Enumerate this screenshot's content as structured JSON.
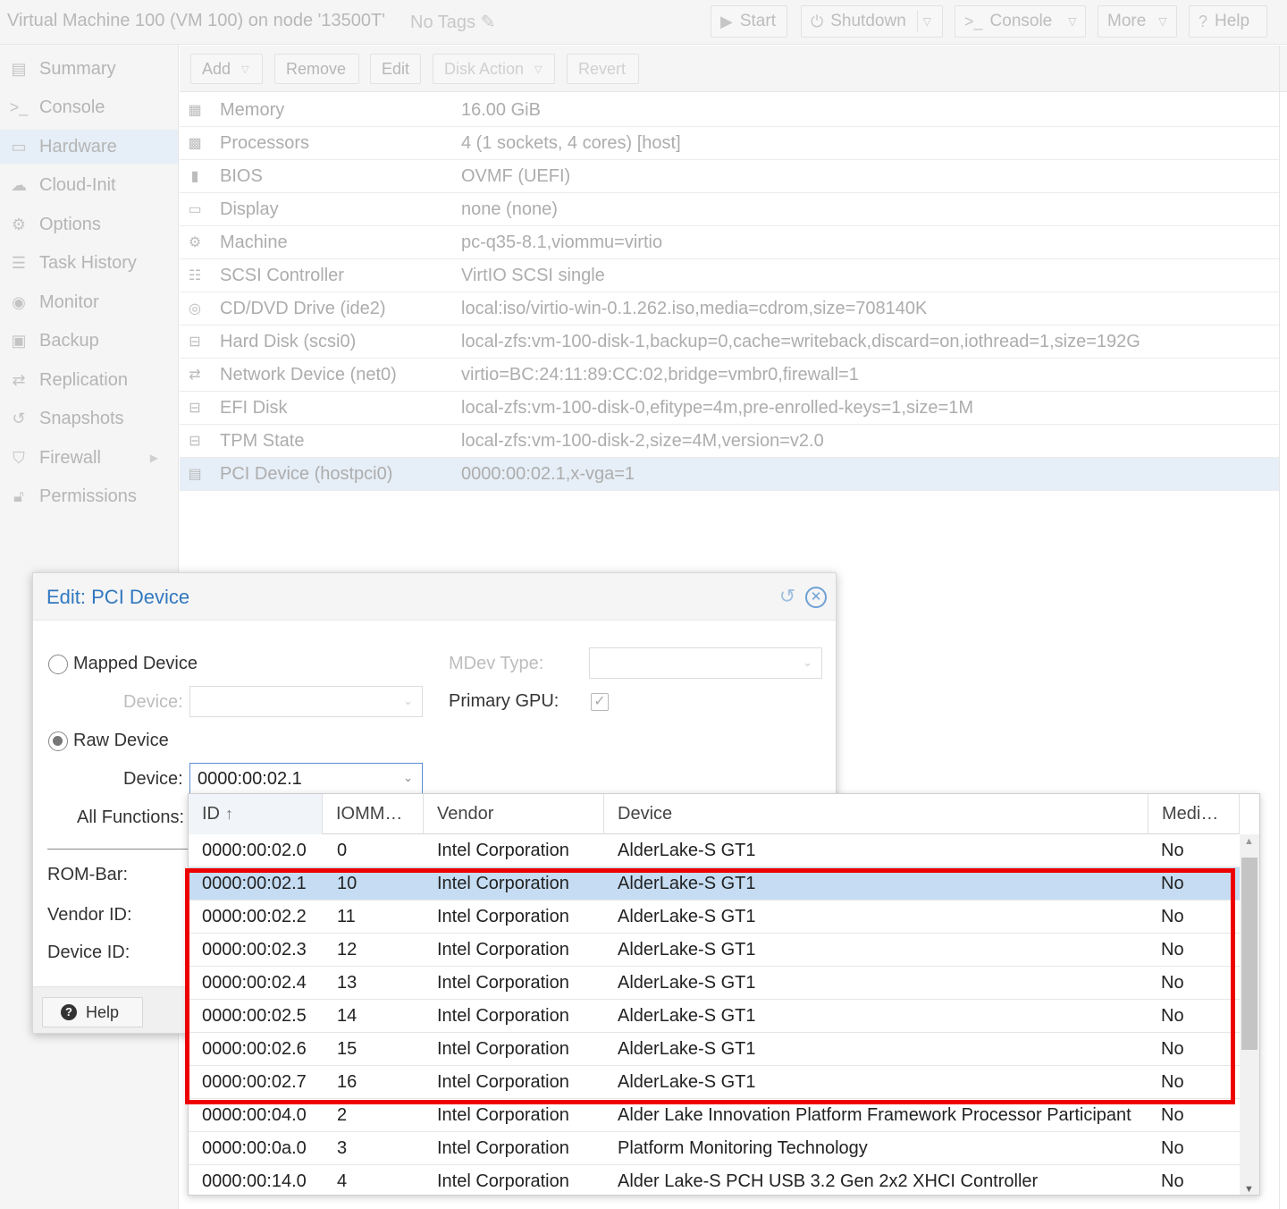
{
  "header": {
    "title": "Virtual Machine 100 (VM 100) on node '13500T'",
    "tags": "No Tags",
    "buttons": {
      "start": "Start",
      "shutdown": "Shutdown",
      "console": "Console",
      "more": "More",
      "help": "Help"
    }
  },
  "sidebar": {
    "items": [
      {
        "label": "Summary",
        "icon": "book-icon"
      },
      {
        "label": "Console",
        "icon": "terminal-icon"
      },
      {
        "label": "Hardware",
        "icon": "desktop-icon",
        "active": true
      },
      {
        "label": "Cloud-Init",
        "icon": "cloud-icon"
      },
      {
        "label": "Options",
        "icon": "gear-icon"
      },
      {
        "label": "Task History",
        "icon": "list-icon"
      },
      {
        "label": "Monitor",
        "icon": "eye-icon"
      },
      {
        "label": "Backup",
        "icon": "floppy-icon"
      },
      {
        "label": "Replication",
        "icon": "retweet-icon"
      },
      {
        "label": "Snapshots",
        "icon": "history-icon"
      },
      {
        "label": "Firewall",
        "icon": "shield-icon"
      },
      {
        "label": "Permissions",
        "icon": "unlock-icon"
      }
    ]
  },
  "toolbar": {
    "add": "Add",
    "remove": "Remove",
    "edit": "Edit",
    "disk_action": "Disk Action",
    "revert": "Revert"
  },
  "hardware": [
    {
      "key": "Memory",
      "value": "16.00 GiB",
      "icon": "memory-icon"
    },
    {
      "key": "Processors",
      "value": "4 (1 sockets, 4 cores) [host]",
      "icon": "cpu-icon"
    },
    {
      "key": "BIOS",
      "value": "OVMF (UEFI)",
      "icon": "microchip-icon"
    },
    {
      "key": "Display",
      "value": "none (none)",
      "icon": "monitor-icon"
    },
    {
      "key": "Machine",
      "value": "pc-q35-8.1,viommu=virtio",
      "icon": "cogs-icon"
    },
    {
      "key": "SCSI Controller",
      "value": "VirtIO SCSI single",
      "icon": "database-icon"
    },
    {
      "key": "CD/DVD Drive (ide2)",
      "value": "local:iso/virtio-win-0.1.262.iso,media=cdrom,size=708140K",
      "icon": "cdrom-icon"
    },
    {
      "key": "Hard Disk (scsi0)",
      "value": "local-zfs:vm-100-disk-1,backup=0,cache=writeback,discard=on,iothread=1,size=192G",
      "icon": "hdd-icon"
    },
    {
      "key": "Network Device (net0)",
      "value": "virtio=BC:24:11:89:CC:02,bridge=vmbr0,firewall=1",
      "icon": "exchange-icon"
    },
    {
      "key": "EFI Disk",
      "value": "local-zfs:vm-100-disk-0,efitype=4m,pre-enrolled-keys=1,size=1M",
      "icon": "hdd-icon"
    },
    {
      "key": "TPM State",
      "value": "local-zfs:vm-100-disk-2,size=4M,version=v2.0",
      "icon": "hdd-icon"
    },
    {
      "key": "PCI Device (hostpci0)",
      "value": "0000:00:02.1,x-vga=1",
      "icon": "pci-card-icon",
      "selected": true
    }
  ],
  "dialog": {
    "title": "Edit: PCI Device",
    "mapped_device": "Mapped Device",
    "device_label": "Device:",
    "mdev_type": "MDev Type:",
    "primary_gpu": "Primary GPU:",
    "raw_device": "Raw Device",
    "raw_device_value": "0000:00:02.1",
    "all_functions": "All Functions:",
    "rom_bar": "ROM-Bar:",
    "vendor_id": "Vendor ID:",
    "device_id": "Device ID:",
    "help": "Help"
  },
  "picker": {
    "columns": [
      "ID",
      "IOMM…",
      "Vendor",
      "Device",
      "Medi…"
    ],
    "rows": [
      {
        "id": "0000:00:02.0",
        "iommu": "0",
        "vendor": "Intel Corporation",
        "device": "AlderLake-S GT1",
        "mdev": "No"
      },
      {
        "id": "0000:00:02.1",
        "iommu": "10",
        "vendor": "Intel Corporation",
        "device": "AlderLake-S GT1",
        "mdev": "No",
        "selected": true
      },
      {
        "id": "0000:00:02.2",
        "iommu": "11",
        "vendor": "Intel Corporation",
        "device": "AlderLake-S GT1",
        "mdev": "No"
      },
      {
        "id": "0000:00:02.3",
        "iommu": "12",
        "vendor": "Intel Corporation",
        "device": "AlderLake-S GT1",
        "mdev": "No"
      },
      {
        "id": "0000:00:02.4",
        "iommu": "13",
        "vendor": "Intel Corporation",
        "device": "AlderLake-S GT1",
        "mdev": "No"
      },
      {
        "id": "0000:00:02.5",
        "iommu": "14",
        "vendor": "Intel Corporation",
        "device": "AlderLake-S GT1",
        "mdev": "No"
      },
      {
        "id": "0000:00:02.6",
        "iommu": "15",
        "vendor": "Intel Corporation",
        "device": "AlderLake-S GT1",
        "mdev": "No"
      },
      {
        "id": "0000:00:02.7",
        "iommu": "16",
        "vendor": "Intel Corporation",
        "device": "AlderLake-S GT1",
        "mdev": "No"
      },
      {
        "id": "0000:00:04.0",
        "iommu": "2",
        "vendor": "Intel Corporation",
        "device": "Alder Lake Innovation Platform Framework Processor Participant",
        "mdev": "No"
      },
      {
        "id": "0000:00:0a.0",
        "iommu": "3",
        "vendor": "Intel Corporation",
        "device": "Platform Monitoring Technology",
        "mdev": "No"
      },
      {
        "id": "0000:00:14.0",
        "iommu": "4",
        "vendor": "Intel Corporation",
        "device": "Alder Lake-S PCH USB 3.2 Gen 2x2 XHCI Controller",
        "mdev": "No"
      }
    ]
  },
  "colors": {
    "accent": "#3178c0",
    "selection": "#c5dcf2",
    "annotation_box": "#ee0000"
  }
}
